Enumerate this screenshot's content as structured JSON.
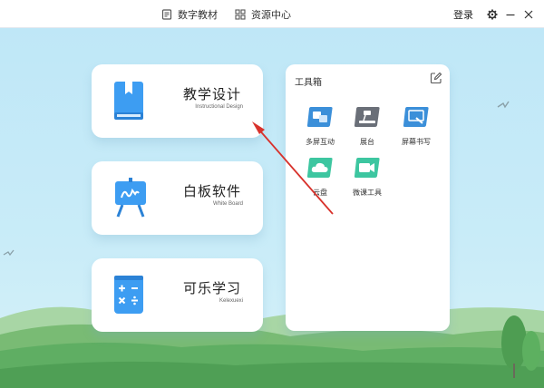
{
  "titlebar": {
    "nav": [
      {
        "label": "数字教材",
        "icon": "book-page-icon"
      },
      {
        "label": "资源中心",
        "icon": "grid-icon"
      }
    ],
    "login_label": "登录"
  },
  "cards": [
    {
      "title": "教学设计",
      "subtitle": "Instructional Design",
      "icon": "book-icon"
    },
    {
      "title": "白板软件",
      "subtitle": "White Board",
      "icon": "whiteboard-icon"
    },
    {
      "title": "可乐学习",
      "subtitle": "Kelexuexi",
      "icon": "calculator-icon"
    }
  ],
  "toolbox": {
    "title": "工具箱",
    "tools": [
      {
        "label": "多屏互动",
        "icon": "multi-screen-icon"
      },
      {
        "label": "展台",
        "icon": "document-camera-icon"
      },
      {
        "label": "屏幕书写",
        "icon": "screen-write-icon"
      },
      {
        "label": "云盘",
        "icon": "cloud-icon"
      },
      {
        "label": "微课工具",
        "icon": "video-camera-icon"
      }
    ]
  },
  "colors": {
    "accent_blue": "#3d9df2",
    "tool_blue": "#3b8fd9",
    "tool_gray": "#6a6f78",
    "tool_green": "#3dc6a0",
    "sky": "#c4e9f7",
    "hill": "#5fae63"
  }
}
